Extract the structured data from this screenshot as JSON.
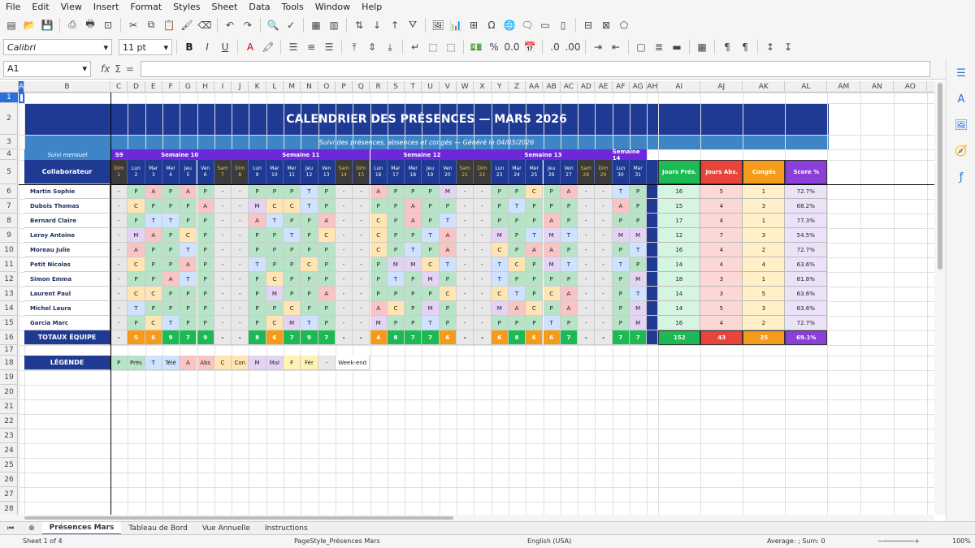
{
  "menus": [
    "File",
    "Edit",
    "View",
    "Insert",
    "Format",
    "Styles",
    "Sheet",
    "Data",
    "Tools",
    "Window",
    "Help"
  ],
  "toolbar": {
    "font_name": "Calibri",
    "font_size": "11 pt",
    "bold": "B",
    "italic": "I",
    "underline": "U",
    "percent": "%",
    "decimal": "0.0"
  },
  "formula": {
    "cell_ref": "A1",
    "fx": "fx",
    "sigma": "Σ",
    "equals": "="
  },
  "columns": [
    "A",
    "B",
    "C",
    "D",
    "E",
    "F",
    "G",
    "H",
    "I",
    "J",
    "K",
    "L",
    "M",
    "N",
    "O",
    "P",
    "Q",
    "R",
    "S",
    "T",
    "U",
    "V",
    "W",
    "X",
    "Y",
    "Z",
    "AA",
    "AB",
    "AC",
    "AD",
    "AE",
    "AF",
    "AG",
    "AH",
    "AI",
    "AJ",
    "AK",
    "AL",
    "AM",
    "AN",
    "AO"
  ],
  "rows": [
    "1",
    "2",
    "3",
    "4",
    "5",
    "6",
    "7",
    "8",
    "9",
    "10",
    "11",
    "12",
    "13",
    "14",
    "15",
    "16",
    "17",
    "18",
    "19",
    "20",
    "21",
    "22",
    "23",
    "24",
    "25",
    "26",
    "27",
    "28",
    "29",
    "30",
    "31"
  ],
  "sheet": {
    "title": "CALENDRIER DES PRÉSENCES — MARS 2026",
    "subtitle": "Suivi des présences, absences et congés — Généré le 04/03/2026",
    "suivi": "Suivi mensuel",
    "weeks": [
      "S9",
      "Semaine 10",
      "Semaine 11",
      "Semaine 12",
      "Semaine 13",
      "Semaine 14"
    ],
    "collab_header": "Collaborateur",
    "days": [
      [
        "Dim",
        "1"
      ],
      [
        "Lun",
        "2"
      ],
      [
        "Mar",
        "3"
      ],
      [
        "Mer",
        "4"
      ],
      [
        "Jeu",
        "5"
      ],
      [
        "Ven",
        "6"
      ],
      [
        "Sam",
        "7"
      ],
      [
        "Dim",
        "8"
      ],
      [
        "Lun",
        "9"
      ],
      [
        "Mar",
        "10"
      ],
      [
        "Mer",
        "11"
      ],
      [
        "Jeu",
        "12"
      ],
      [
        "Ven",
        "13"
      ],
      [
        "Sam",
        "14"
      ],
      [
        "Dim",
        "15"
      ],
      [
        "Lun",
        "16"
      ],
      [
        "Mar",
        "17"
      ],
      [
        "Mer",
        "18"
      ],
      [
        "Jeu",
        "19"
      ],
      [
        "Ven",
        "20"
      ],
      [
        "Sam",
        "21"
      ],
      [
        "Dim",
        "22"
      ],
      [
        "Lun",
        "23"
      ],
      [
        "Mar",
        "24"
      ],
      [
        "Mer",
        "25"
      ],
      [
        "Jeu",
        "26"
      ],
      [
        "Ven",
        "27"
      ],
      [
        "Sam",
        "28"
      ],
      [
        "Dim",
        "29"
      ],
      [
        "Lun",
        "30"
      ],
      [
        "Mar",
        "31"
      ]
    ],
    "stat_headers": [
      "Jours Prés.",
      "Jours Abs.",
      "Congés",
      "Score %"
    ],
    "employees": [
      {
        "name": "Martin Sophie",
        "marks": [
          "-",
          "P",
          "A",
          "P",
          "A",
          "P",
          "-",
          "-",
          "P",
          "P",
          "P",
          "T",
          "P",
          "-",
          "-",
          "A",
          "P",
          "P",
          "P",
          "M",
          "-",
          "-",
          "P",
          "P",
          "C",
          "P",
          "A",
          "-",
          "-",
          "T",
          "P"
        ],
        "stats": [
          "16",
          "5",
          "1",
          "72.7%"
        ]
      },
      {
        "name": "Dubois Thomas",
        "marks": [
          "-",
          "C",
          "P",
          "P",
          "P",
          "A",
          "-",
          "-",
          "M",
          "C",
          "C",
          "T",
          "P",
          "-",
          "-",
          "P",
          "P",
          "A",
          "P",
          "P",
          "-",
          "-",
          "P",
          "T",
          "P",
          "P",
          "P",
          "-",
          "-",
          "A",
          "P"
        ],
        "stats": [
          "15",
          "4",
          "3",
          "68.2%"
        ]
      },
      {
        "name": "Bernard Claire",
        "marks": [
          "-",
          "P",
          "T",
          "T",
          "P",
          "P",
          "-",
          "-",
          "A",
          "T",
          "P",
          "P",
          "A",
          "-",
          "-",
          "C",
          "P",
          "A",
          "P",
          "T",
          "-",
          "-",
          "P",
          "P",
          "P",
          "A",
          "P",
          "-",
          "-",
          "P",
          "P"
        ],
        "stats": [
          "17",
          "4",
          "1",
          "77.3%"
        ]
      },
      {
        "name": "Leroy Antoine",
        "marks": [
          "-",
          "M",
          "A",
          "P",
          "C",
          "P",
          "-",
          "-",
          "P",
          "P",
          "T",
          "P",
          "C",
          "-",
          "-",
          "C",
          "P",
          "P",
          "T",
          "A",
          "-",
          "-",
          "M",
          "P",
          "T",
          "M",
          "T",
          "-",
          "-",
          "M",
          "M"
        ],
        "stats": [
          "12",
          "7",
          "3",
          "54.5%"
        ]
      },
      {
        "name": "Moreau Julie",
        "marks": [
          "-",
          "A",
          "P",
          "P",
          "T",
          "P",
          "-",
          "-",
          "P",
          "P",
          "P",
          "P",
          "P",
          "-",
          "-",
          "C",
          "P",
          "T",
          "P",
          "A",
          "-",
          "-",
          "C",
          "P",
          "A",
          "A",
          "P",
          "-",
          "-",
          "P",
          "T"
        ],
        "stats": [
          "16",
          "4",
          "2",
          "72.7%"
        ]
      },
      {
        "name": "Petit Nicolas",
        "marks": [
          "-",
          "C",
          "P",
          "P",
          "A",
          "P",
          "-",
          "-",
          "T",
          "P",
          "P",
          "C",
          "P",
          "-",
          "-",
          "P",
          "M",
          "M",
          "C",
          "T",
          "-",
          "-",
          "T",
          "C",
          "P",
          "M",
          "T",
          "-",
          "-",
          "T",
          "P"
        ],
        "stats": [
          "14",
          "4",
          "4",
          "63.6%"
        ]
      },
      {
        "name": "Simon Emma",
        "marks": [
          "-",
          "P",
          "P",
          "A",
          "T",
          "P",
          "-",
          "-",
          "P",
          "C",
          "P",
          "P",
          "P",
          "-",
          "-",
          "P",
          "T",
          "P",
          "M",
          "P",
          "-",
          "-",
          "T",
          "P",
          "P",
          "P",
          "P",
          "-",
          "-",
          "P",
          "M"
        ],
        "stats": [
          "18",
          "3",
          "1",
          "81.8%"
        ]
      },
      {
        "name": "Laurent Paul",
        "marks": [
          "-",
          "C",
          "C",
          "P",
          "P",
          "P",
          "-",
          "-",
          "P",
          "M",
          "P",
          "P",
          "A",
          "-",
          "-",
          "P",
          "P",
          "P",
          "P",
          "C",
          "-",
          "-",
          "C",
          "T",
          "P",
          "C",
          "A",
          "-",
          "-",
          "P",
          "T"
        ],
        "stats": [
          "14",
          "3",
          "5",
          "63.6%"
        ]
      },
      {
        "name": "Michel Laura",
        "marks": [
          "-",
          "T",
          "P",
          "P",
          "P",
          "P",
          "-",
          "-",
          "P",
          "P",
          "C",
          "P",
          "P",
          "-",
          "-",
          "A",
          "C",
          "P",
          "M",
          "P",
          "-",
          "-",
          "M",
          "A",
          "C",
          "P",
          "A",
          "-",
          "-",
          "P",
          "M"
        ],
        "stats": [
          "14",
          "5",
          "3",
          "63.6%"
        ]
      },
      {
        "name": "Garcia Marc",
        "marks": [
          "-",
          "P",
          "C",
          "T",
          "P",
          "P",
          "-",
          "-",
          "P",
          "C",
          "M",
          "T",
          "P",
          "-",
          "-",
          "M",
          "P",
          "P",
          "T",
          "P",
          "-",
          "-",
          "P",
          "P",
          "P",
          "T",
          "P",
          "-",
          "-",
          "P",
          "M"
        ],
        "stats": [
          "16",
          "4",
          "2",
          "72.7%"
        ]
      }
    ],
    "totals_label": "TOTAUX ÉQUIPE",
    "totals": [
      "-",
      "5",
      "6",
      "9",
      "7",
      "9",
      "-",
      "-",
      "8",
      "6",
      "7",
      "9",
      "7",
      "-",
      "-",
      "4",
      "8",
      "7",
      "7",
      "6",
      "-",
      "-",
      "6",
      "8",
      "6",
      "6",
      "7",
      "-",
      "-",
      "7",
      "7"
    ],
    "totals_stats": [
      "152",
      "43",
      "25",
      "69.1%"
    ],
    "legend_label": "LÉGENDE",
    "legend": [
      [
        "P",
        "Prés"
      ],
      [
        "T",
        "Télé"
      ],
      [
        "A",
        "Abs"
      ],
      [
        "C",
        "Con"
      ],
      [
        "M",
        "Mal"
      ],
      [
        "F",
        "Fér"
      ],
      [
        "-",
        "Week-end"
      ]
    ]
  },
  "colors": {
    "P": "#b7e4c7",
    "A": "#f8c4c4",
    "T": "#cfe2ff",
    "C": "#ffe5b4",
    "M": "#e4d4f4",
    "F": "#fff2b3",
    "-": "#e8e8e8",
    "navy": "#1f3a93",
    "purple": "#6d28d9",
    "green": "#1db954",
    "red": "#e8443a",
    "orange": "#f59b1c",
    "violet": "#8b3fd9"
  },
  "tabs": [
    "Présences Mars",
    "Tableau de Bord",
    "Vue Annuelle",
    "Instructions"
  ],
  "status": {
    "sheet": "Sheet 1 of 4",
    "pagestyle": "PageStyle_Présences Mars",
    "lang": "English (USA)",
    "sum": "Average: ; Sum: 0",
    "zoom": "100%"
  }
}
